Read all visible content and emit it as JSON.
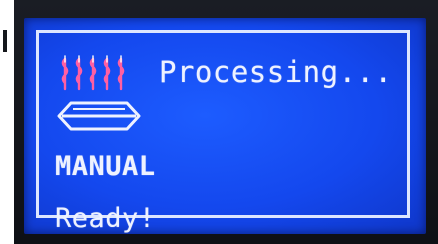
{
  "screen": {
    "status_text": "Processing...",
    "mode_text": "MANUAL",
    "ready_text": "Ready!"
  },
  "icons": {
    "heat": "heating-element-icon",
    "pan": "pan-icon"
  },
  "colors": {
    "lcd_background": "#1448ee",
    "lcd_text": "#eef2ff",
    "heat_icon": "#ff5fa2",
    "frame": "#dde6ff",
    "bezel": "#15171c"
  }
}
